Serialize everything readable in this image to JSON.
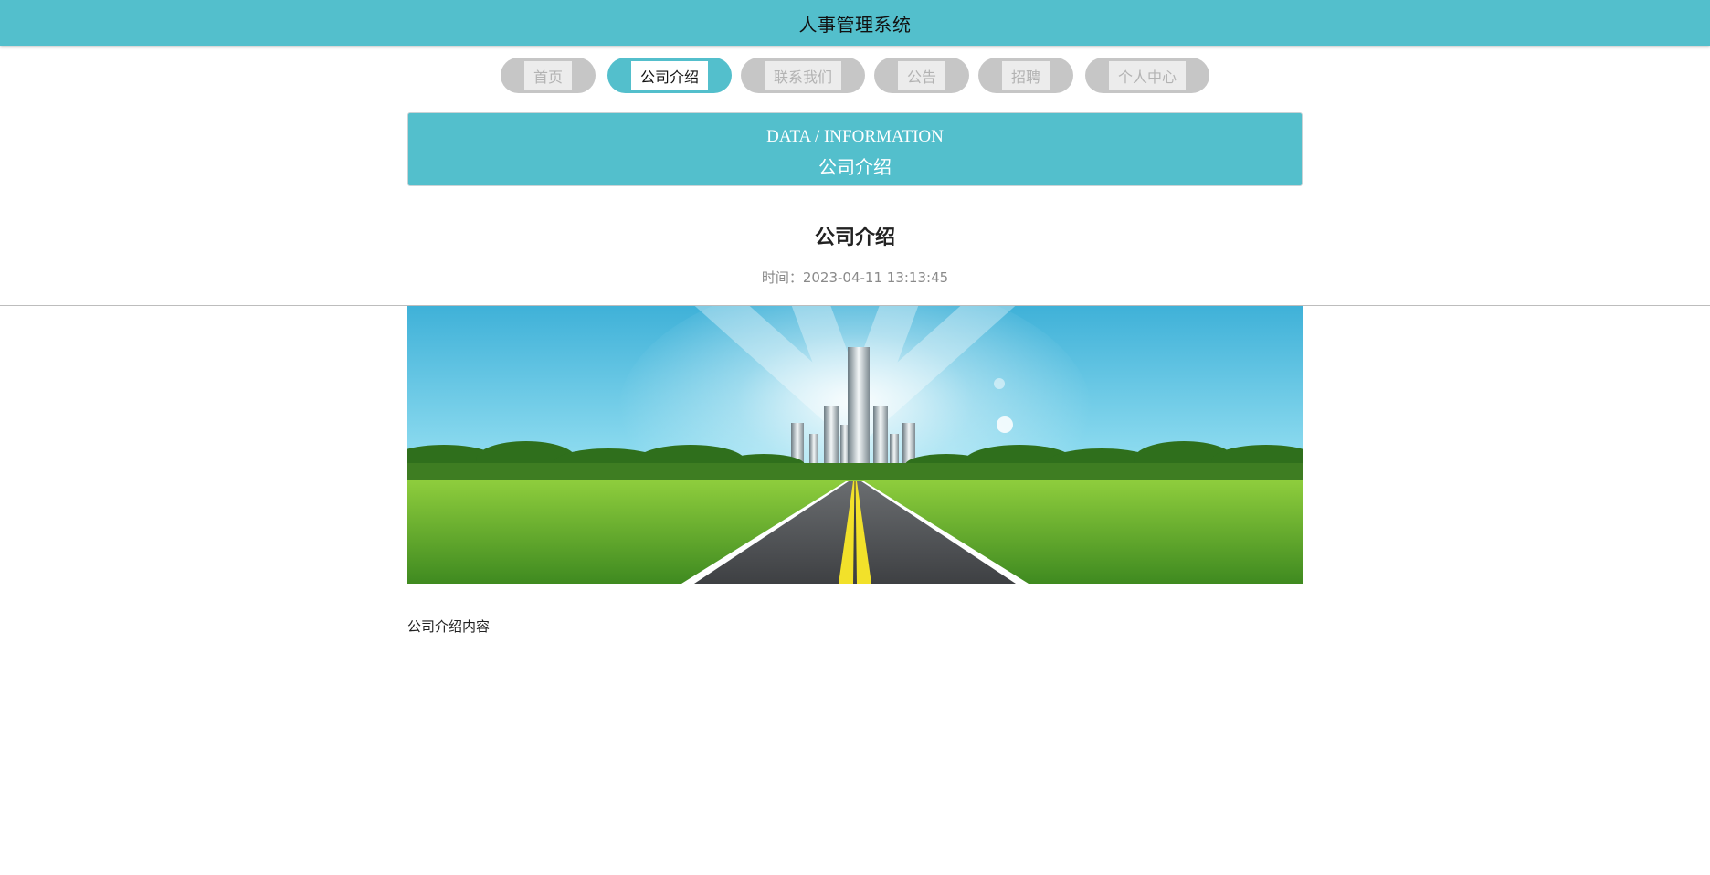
{
  "header": {
    "title": "人事管理系统"
  },
  "nav": {
    "items": [
      {
        "label": "首页",
        "active": false
      },
      {
        "label": "公司介绍",
        "active": true
      },
      {
        "label": "联系我们",
        "active": false
      },
      {
        "label": "公告",
        "active": false
      },
      {
        "label": "招聘",
        "active": false
      },
      {
        "label": "个人中心",
        "active": false
      }
    ]
  },
  "banner": {
    "english": "DATA / INFORMATION",
    "chinese": "公司介绍"
  },
  "article": {
    "title": "公司介绍",
    "time": "时间：2023-04-11 13:13:45",
    "image_alt": "road-to-city-illustration",
    "content": "公司介绍内容"
  },
  "colors": {
    "accent": "#53bfcc",
    "nav_inactive": "#c6c6c6"
  }
}
